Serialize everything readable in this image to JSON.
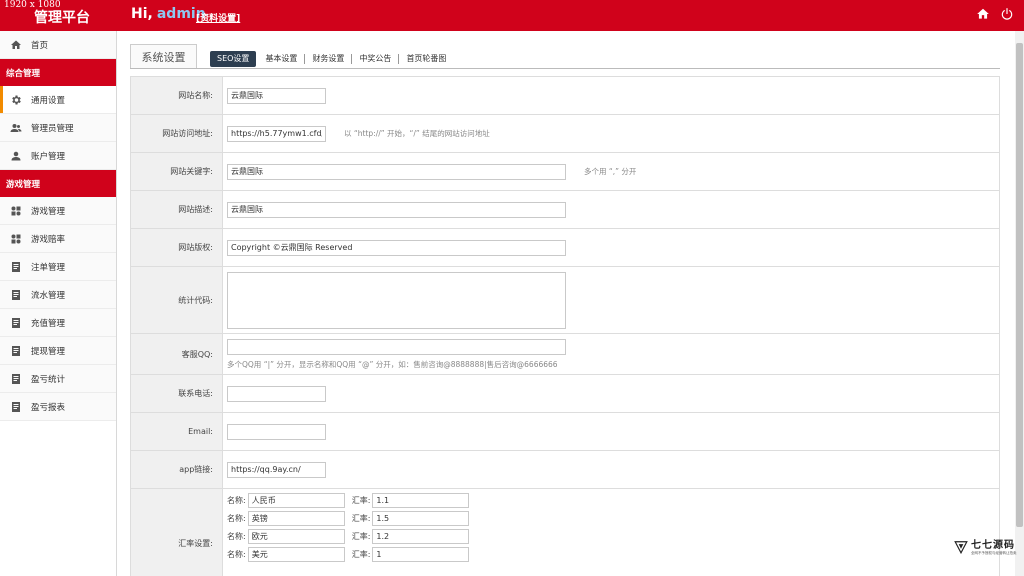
{
  "overlay": {
    "resolution": "1920 x 1080"
  },
  "header": {
    "brand": "管理平台",
    "greeting": "Hi,",
    "username": "admin",
    "profile_link": "[资料设置]",
    "icons": [
      "home-icon",
      "power-icon"
    ]
  },
  "sidebar": {
    "items": [
      {
        "label": "首页",
        "icon": "home-icon"
      },
      {
        "group": "综合管理"
      },
      {
        "label": "通用设置",
        "icon": "gear-icon",
        "active": true
      },
      {
        "label": "管理员管理",
        "icon": "users-icon"
      },
      {
        "label": "账户管理",
        "icon": "user-icon"
      },
      {
        "group": "游戏管理"
      },
      {
        "label": "游戏管理",
        "icon": "grid-icon"
      },
      {
        "label": "游戏赔率",
        "icon": "grid-icon"
      },
      {
        "label": "注单管理",
        "icon": "doc-icon"
      },
      {
        "label": "流水管理",
        "icon": "doc-icon"
      },
      {
        "label": "充值管理",
        "icon": "doc-icon"
      },
      {
        "label": "提现管理",
        "icon": "doc-icon"
      },
      {
        "label": "盈亏统计",
        "icon": "doc-icon"
      },
      {
        "label": "盈亏报表",
        "icon": "doc-icon"
      }
    ]
  },
  "main": {
    "section_title": "系统设置",
    "tabs": [
      "SEO设置",
      "基本设置",
      "财务设置",
      "中奖公告",
      "首页轮番图"
    ],
    "form": {
      "site_name": {
        "label": "网站名称:",
        "value": "云鼎国际"
      },
      "site_url": {
        "label": "网站访问地址:",
        "value": "https://h5.77ymw1.cfd/",
        "hint": "以 “http://” 开始，“/” 结尾的网站访问地址"
      },
      "keywords": {
        "label": "网站关键字:",
        "value": "云鼎国际",
        "hint": "多个用 “,” 分开"
      },
      "description": {
        "label": "网站描述:",
        "value": "云鼎国际"
      },
      "copyright": {
        "label": "网站版权:",
        "value": "Copyright ©云鼎国际 Reserved"
      },
      "stats_code": {
        "label": "统计代码:",
        "value": ""
      },
      "qq": {
        "label": "客服QQ:",
        "value": "",
        "hint": "多个QQ用 “|” 分开，显示名称和QQ用 “@” 分开，如：售前咨询@8888888|售后咨询@6666666"
      },
      "phone": {
        "label": "联系电话:",
        "value": ""
      },
      "email": {
        "label": "Email:",
        "value": ""
      },
      "app_link": {
        "label": "app链接:",
        "value": "https://qq.9ay.cn/"
      },
      "rates": {
        "label": "汇率设置:",
        "name_label": "名称:",
        "rate_label": "汇率:",
        "rows": [
          {
            "name": "人民币",
            "rate": "1.1"
          },
          {
            "name": "英镑",
            "rate": "1.5"
          },
          {
            "name": "欧元",
            "rate": "1.2"
          },
          {
            "name": "美元",
            "rate": "1"
          }
        ]
      }
    }
  },
  "watermark": {
    "title": "七七源码",
    "subtitle": "全网不予授权与经营转让拍卖"
  }
}
